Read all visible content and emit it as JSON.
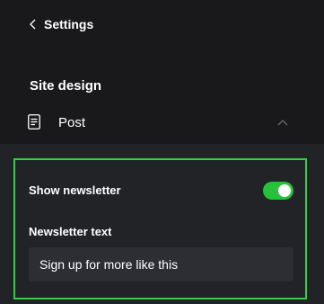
{
  "nav": {
    "back_label": "Settings"
  },
  "site_design": {
    "title": "Site design",
    "section": {
      "label": "Post",
      "expanded": true
    }
  },
  "newsletter": {
    "toggle_label": "Show newsletter",
    "toggle_on": true,
    "text_label": "Newsletter text",
    "text_value": "Sign up for more like this"
  },
  "colors": {
    "background": "#19191b",
    "panel": "#222327",
    "highlight_border": "#3cc947",
    "toggle_on": "#27c13b",
    "input_bg": "#2d2e33"
  },
  "icons": [
    "chevron-left-icon",
    "document-icon",
    "chevron-up-icon"
  ]
}
